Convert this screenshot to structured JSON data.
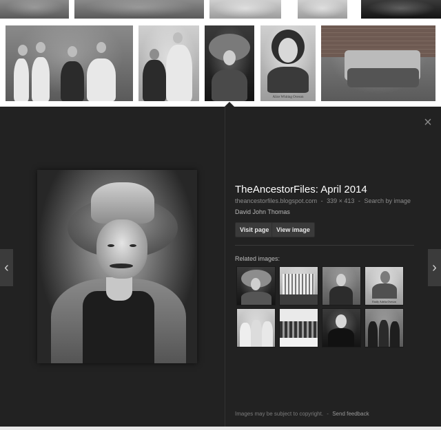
{
  "top_grid": {
    "row2_captions": [
      "",
      "",
      "",
      "Alice Whiting Oveson",
      ""
    ]
  },
  "preview": {
    "close_icon": "×",
    "nav_prev_icon": "‹",
    "nav_next_icon": "›",
    "title": "TheAncestorFiles: April 2014",
    "site": "theancestorfiles.blogspot.com",
    "separator": "-",
    "dimensions": "339 × 413",
    "search_by_image": "Search by image",
    "author": "David John Thomas",
    "visit_page": "Visit page",
    "view_image": "View image",
    "related_label": "Related images:",
    "related_captions": [
      "",
      "",
      "",
      "Emily Adelia Oveson",
      "",
      "",
      "",
      ""
    ],
    "footer_note": "Images may be subject to copyright.",
    "footer_sep": "-",
    "send_feedback": "Send feedback"
  }
}
